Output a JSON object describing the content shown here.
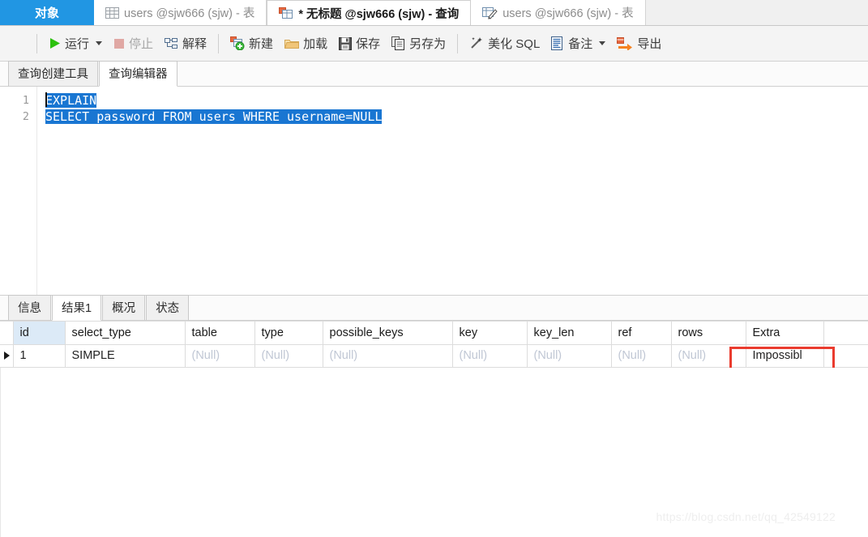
{
  "window": {
    "top_tabs": [
      {
        "label": "对象",
        "icon": "object-icon",
        "state": "selected-blue"
      },
      {
        "label": "users @sjw666 (sjw) - 表",
        "icon": "table-grid-icon",
        "state": "inactive"
      },
      {
        "label": "* 无标题 @sjw666 (sjw) - 查询",
        "icon": "query-window-icon",
        "state": "active"
      },
      {
        "label": "users @sjw666 (sjw) - 表",
        "icon": "table-edit-icon",
        "state": "inactive"
      }
    ]
  },
  "toolbar": {
    "menu_label": "",
    "items": [
      {
        "label": "运行",
        "icon": "play-icon",
        "has_dropdown": true,
        "enabled": true
      },
      {
        "label": "停止",
        "icon": "stop-icon",
        "has_dropdown": false,
        "enabled": false
      },
      {
        "label": "解释",
        "icon": "explain-icon",
        "has_dropdown": false,
        "enabled": true
      },
      {
        "label": "新建",
        "icon": "new-query-icon",
        "has_dropdown": false,
        "enabled": true
      },
      {
        "label": "加载",
        "icon": "folder-open-icon",
        "has_dropdown": false,
        "enabled": true
      },
      {
        "label": "保存",
        "icon": "save-disk-icon",
        "has_dropdown": false,
        "enabled": true
      },
      {
        "label": "另存为",
        "icon": "save-as-icon",
        "has_dropdown": false,
        "enabled": true
      },
      {
        "label": "美化 SQL",
        "icon": "magic-wand-icon",
        "has_dropdown": false,
        "enabled": true
      },
      {
        "label": "备注",
        "icon": "comment-doc-icon",
        "has_dropdown": true,
        "enabled": true
      },
      {
        "label": "导出",
        "icon": "export-arrow-icon",
        "has_dropdown": false,
        "enabled": true
      }
    ]
  },
  "sub_tabs": [
    {
      "label": "查询创建工具",
      "active": false
    },
    {
      "label": "查询编辑器",
      "active": true
    }
  ],
  "editor": {
    "line_numbers": [
      "1",
      "2"
    ],
    "lines": [
      "EXPLAIN",
      "SELECT password FROM users WHERE username=NULL"
    ],
    "selection_color": "#1976d2"
  },
  "result_tabs": [
    {
      "label": "信息",
      "active": false
    },
    {
      "label": "结果1",
      "active": true
    },
    {
      "label": "概况",
      "active": false
    },
    {
      "label": "状态",
      "active": false
    }
  ],
  "result_grid": {
    "columns": [
      "id",
      "select_type",
      "table",
      "type",
      "possible_keys",
      "key",
      "key_len",
      "ref",
      "rows",
      "Extra"
    ],
    "rows": [
      {
        "marker": "▶",
        "cells": [
          "1",
          "SIMPLE",
          "(Null)",
          "(Null)",
          "(Null)",
          "(Null)",
          "(Null)",
          "(Null)",
          "(Null)",
          "Impossibl"
        ]
      }
    ],
    "null_text": "(Null)",
    "highlight_color": "#ea3b2e",
    "highlighted_cell": "Extra"
  },
  "watermark": "https://blog.csdn.net/qq_42549122"
}
